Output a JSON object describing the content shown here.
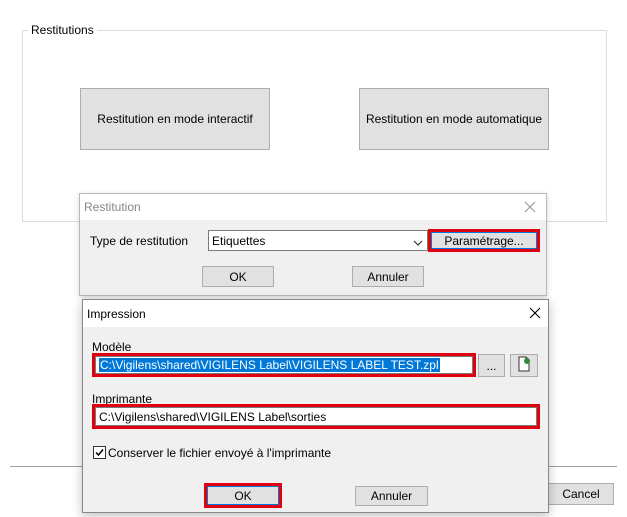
{
  "background_window": {
    "group_title": "Restitutions",
    "interactive_button": "Restitution en mode interactif",
    "automatic_button": "Restitution en mode automatique",
    "cancel_button": "Cancel"
  },
  "restitution_dialog": {
    "title": "Restitution",
    "type_label": "Type de restitution",
    "type_value": "Etiquettes",
    "settings_button": "Paramétrage...",
    "ok_button": "OK",
    "cancel_button": "Annuler"
  },
  "impression_dialog": {
    "title": "Impression",
    "model_label": "Modèle",
    "model_value": "C:\\Vigilens\\shared\\VIGILENS Label\\VIGILENS LABEL TEST.zpl",
    "browse_button": "...",
    "printer_label": "Imprimante",
    "printer_value": "C:\\Vigilens\\shared\\VIGILENS Label\\sorties",
    "keep_file_label": "Conserver le fichier envoyé à l'imprimante",
    "keep_file_checked": true,
    "ok_button": "OK",
    "cancel_button": "Annuler"
  },
  "colors": {
    "highlight": "#e0000f",
    "selection": "#0078d7"
  }
}
